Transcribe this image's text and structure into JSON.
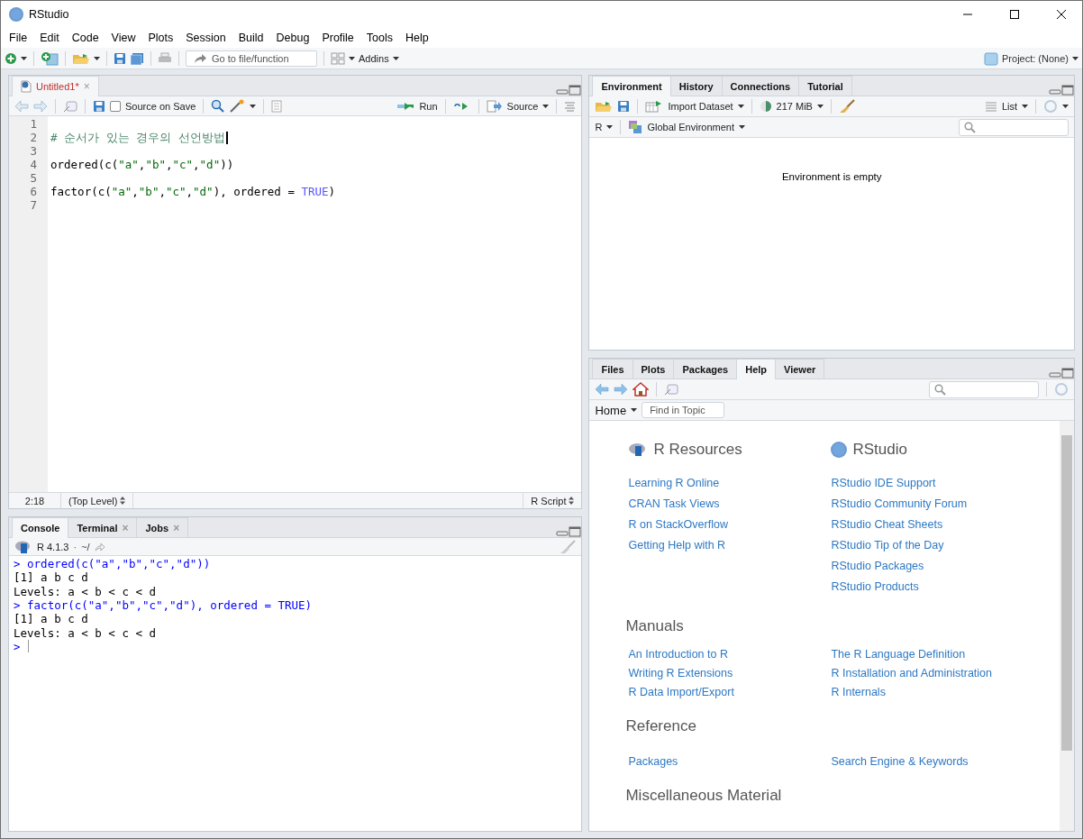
{
  "window": {
    "title": "RStudio"
  },
  "menu": [
    "File",
    "Edit",
    "Code",
    "View",
    "Plots",
    "Session",
    "Build",
    "Debug",
    "Profile",
    "Tools",
    "Help"
  ],
  "toolbar": {
    "goto_placeholder": "Go to file/function",
    "addins": "Addins",
    "project": "Project: (None)"
  },
  "editor": {
    "tabs": [
      {
        "label": "Untitled1*",
        "selected": true,
        "close": "×"
      }
    ],
    "source_on_save": {
      "label": "Source on Save",
      "checked": false
    },
    "run": "Run",
    "source": "Source",
    "lines": [
      {
        "number": "1"
      },
      {
        "number": "2",
        "tokens": [
          {
            "kind": "comment",
            "text": "# 순서가 있는 경우의 선언방법"
          }
        ],
        "cursor": true
      },
      {
        "number": "3"
      },
      {
        "number": "4",
        "tokens": [
          {
            "kind": "plain",
            "text": "ordered(c("
          },
          {
            "kind": "string",
            "text": "\"a\""
          },
          {
            "kind": "plain",
            "text": ","
          },
          {
            "kind": "string",
            "text": "\"b\""
          },
          {
            "kind": "plain",
            "text": ","
          },
          {
            "kind": "string",
            "text": "\"c\""
          },
          {
            "kind": "plain",
            "text": ","
          },
          {
            "kind": "string",
            "text": "\"d\""
          },
          {
            "kind": "plain",
            "text": "))"
          }
        ]
      },
      {
        "number": "5"
      },
      {
        "number": "6",
        "tokens": [
          {
            "kind": "plain",
            "text": "factor(c("
          },
          {
            "kind": "string",
            "text": "\"a\""
          },
          {
            "kind": "plain",
            "text": ","
          },
          {
            "kind": "string",
            "text": "\"b\""
          },
          {
            "kind": "plain",
            "text": ","
          },
          {
            "kind": "string",
            "text": "\"c\""
          },
          {
            "kind": "plain",
            "text": ","
          },
          {
            "kind": "string",
            "text": "\"d\""
          },
          {
            "kind": "plain",
            "text": "), ordered = "
          },
          {
            "kind": "keyword",
            "text": "TRUE"
          },
          {
            "kind": "plain",
            "text": ")"
          }
        ]
      },
      {
        "number": "7"
      }
    ],
    "status": {
      "position": "2:18",
      "scope": "(Top Level)",
      "type": "R Script"
    }
  },
  "console": {
    "tabs": [
      {
        "label": "Console",
        "selected": true
      },
      {
        "label": "Terminal",
        "selected": false,
        "close": "×"
      },
      {
        "label": "Jobs",
        "selected": false,
        "close": "×"
      }
    ],
    "version": "R 4.1.3",
    "separator": "·",
    "path": "~/",
    "lines": [
      {
        "kind": "input",
        "text": "> ordered(c(\"a\",\"b\",\"c\",\"d\"))"
      },
      {
        "kind": "output",
        "text": "[1] a b c d"
      },
      {
        "kind": "output",
        "text": "Levels: a < b < c < d"
      },
      {
        "kind": "input",
        "text": "> factor(c(\"a\",\"b\",\"c\",\"d\"), ordered = TRUE)"
      },
      {
        "kind": "output",
        "text": "[1] a b c d"
      },
      {
        "kind": "output",
        "text": "Levels: a < b < c < d"
      },
      {
        "kind": "prompt",
        "text": ">"
      }
    ]
  },
  "environment": {
    "tabs": [
      {
        "label": "Environment",
        "selected": true
      },
      {
        "label": "History",
        "selected": false
      },
      {
        "label": "Connections",
        "selected": false
      },
      {
        "label": "Tutorial",
        "selected": false
      }
    ],
    "import": "Import Dataset",
    "memory": "217 MiB",
    "view": "List",
    "language": "R",
    "scope": "Global Environment",
    "message": "Environment is empty"
  },
  "help": {
    "tabs": [
      {
        "label": "Files",
        "selected": false
      },
      {
        "label": "Plots",
        "selected": false
      },
      {
        "label": "Packages",
        "selected": false
      },
      {
        "label": "Help",
        "selected": true
      },
      {
        "label": "Viewer",
        "selected": false
      }
    ],
    "home": "Home",
    "find_placeholder": "Find in Topic",
    "resources": [
      {
        "title": "R Resources",
        "links": [
          "Learning R Online",
          "CRAN Task Views",
          "R on StackOverflow",
          "Getting Help with R"
        ]
      },
      {
        "title": "RStudio",
        "links": [
          "RStudio IDE Support",
          "RStudio Community Forum",
          "RStudio Cheat Sheets",
          "RStudio Tip of the Day",
          "RStudio Packages",
          "RStudio Products"
        ]
      }
    ],
    "sections": [
      {
        "title": "Manuals",
        "left": [
          "An Introduction to R",
          "Writing R Extensions",
          "R Data Import/Export"
        ],
        "right": [
          "The R Language Definition",
          "R Installation and Administration",
          "R Internals"
        ]
      },
      {
        "title": "Reference",
        "left": [
          "Packages"
        ],
        "right": [
          "Search Engine & Keywords"
        ]
      },
      {
        "title": "Miscellaneous Material"
      }
    ]
  }
}
